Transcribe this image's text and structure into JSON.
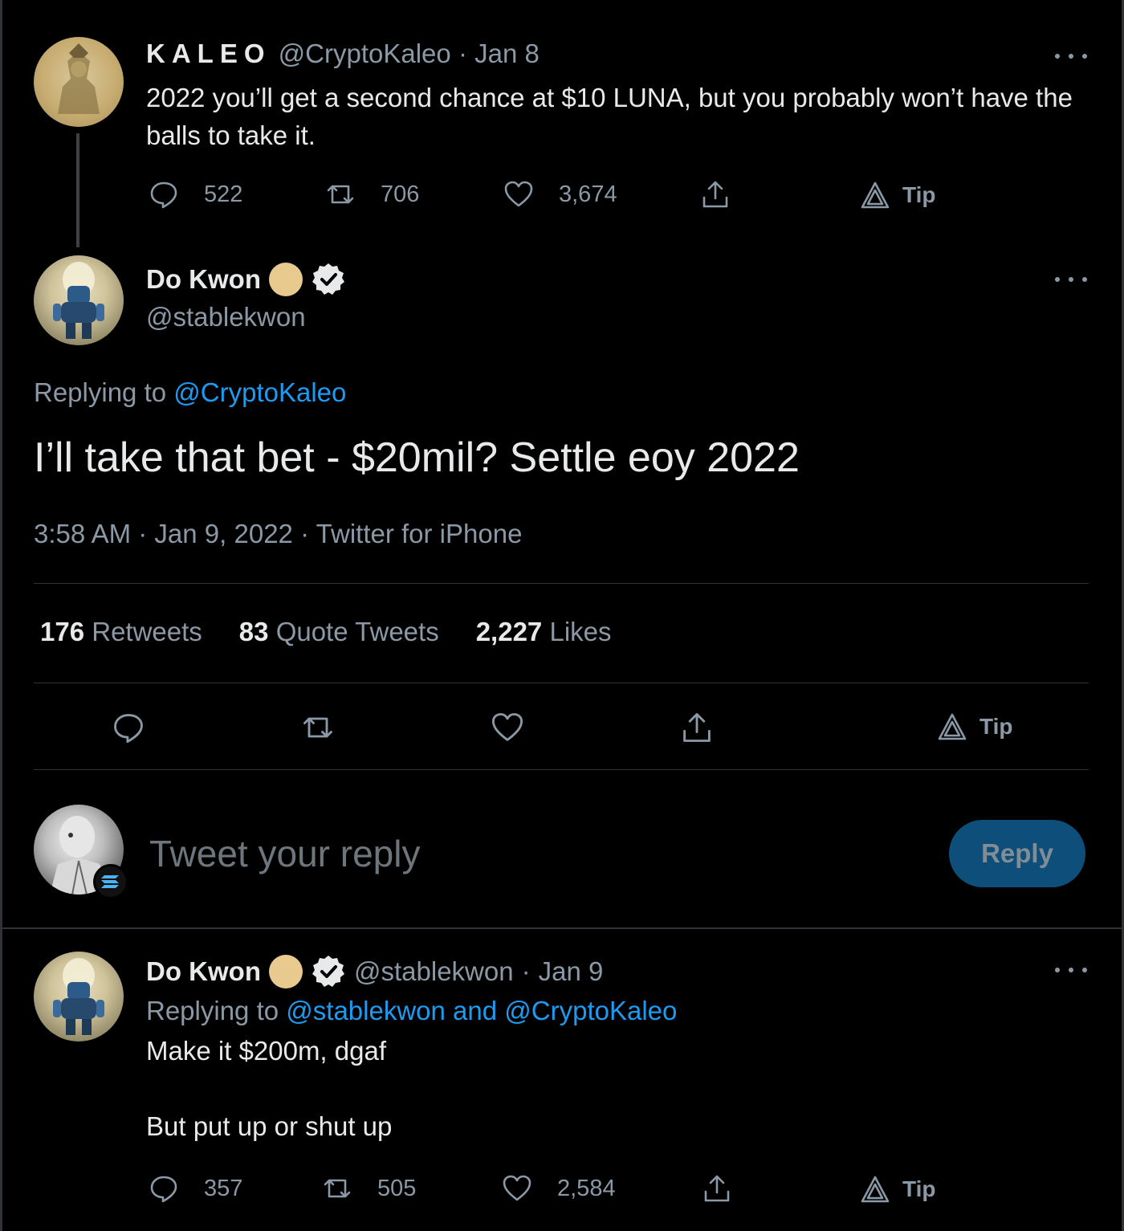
{
  "tweet1": {
    "name": "KALEO",
    "handle": "@CryptoKaleo",
    "date": "Jan 8",
    "separator": "·",
    "text": "2022 you’ll get a second chance at $10 LUNA, but you probably won’t have the balls to take it.",
    "counts": {
      "replies": "522",
      "retweets": "706",
      "likes": "3,674"
    },
    "tip_label": "Tip"
  },
  "main": {
    "name": "Do Kwon",
    "handle": "@stablekwon",
    "replying_prefix": "Replying to",
    "replying_to": "@CryptoKaleo",
    "text": "I’ll take that bet - $20mil? Settle eoy 2022",
    "time": "3:58 AM",
    "date": "Jan 9, 2022",
    "source": "Twitter for iPhone",
    "separator": "·",
    "stats": {
      "retweets_count": "176",
      "retweets_label": "Retweets",
      "quotes_count": "83",
      "quotes_label": "Quote Tweets",
      "likes_count": "2,227",
      "likes_label": "Likes"
    },
    "tip_label": "Tip"
  },
  "compose": {
    "placeholder": "Tweet your reply",
    "reply_button": "Reply"
  },
  "reply": {
    "name": "Do Kwon",
    "handle": "@stablekwon",
    "date": "Jan 9",
    "separator": "·",
    "replying_prefix": "Replying to",
    "replying_to": "@stablekwon and @CryptoKaleo",
    "text_line1": "Make it $200m, dgaf",
    "text_line2": "But put up or shut up",
    "counts": {
      "replies": "357",
      "retweets": "505",
      "likes": "2,584"
    },
    "tip_label": "Tip"
  },
  "colors": {
    "background": "#000000",
    "text": "#e7e9ea",
    "muted": "#8b98a5",
    "link": "#1d9bf0",
    "reply_button": "#0e4e7b"
  }
}
